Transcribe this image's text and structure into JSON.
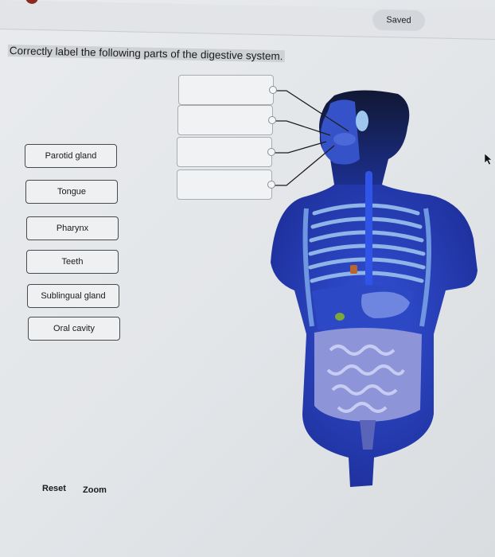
{
  "header": {
    "status_label": "Saved"
  },
  "question": {
    "prompt": "Correctly label the following parts of the digestive system."
  },
  "labels": [
    {
      "text": "Parotid gland"
    },
    {
      "text": "Tongue"
    },
    {
      "text": "Pharynx"
    },
    {
      "text": "Teeth"
    },
    {
      "text": "Sublingual gland"
    },
    {
      "text": "Oral cavity"
    }
  ],
  "drop_slots": [
    {
      "value": ""
    },
    {
      "value": ""
    },
    {
      "value": ""
    },
    {
      "value": ""
    }
  ],
  "diagram": {
    "subject": "human-digestive-system-illustration",
    "colors": {
      "body": "#2b47c8",
      "body_dark": "#1b2c8e",
      "ribs": "#8fb4e8",
      "intestines": "#8d95d8",
      "gallbladder": "#7ba83a",
      "accent_orange": "#b8652e"
    }
  },
  "footer": {
    "reset_label": "Reset",
    "zoom_label": "Zoom"
  }
}
